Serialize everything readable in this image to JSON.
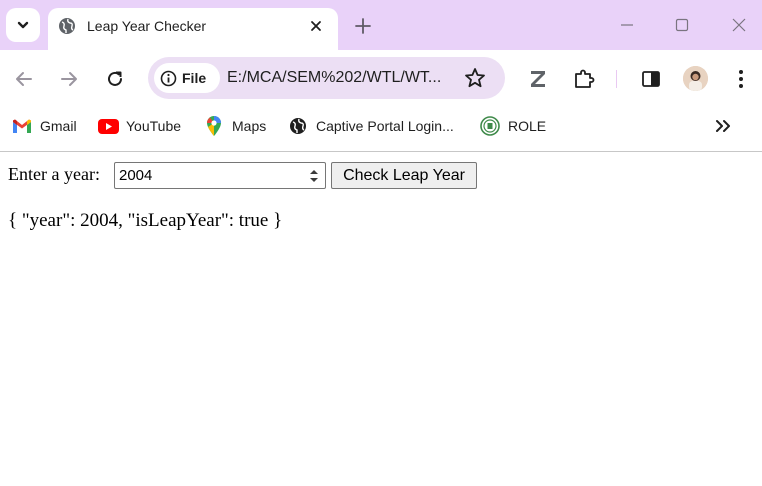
{
  "tab": {
    "title": "Leap Year Checker"
  },
  "omnibox": {
    "chip_label": "File",
    "url": "E:/MCA/SEM%202/WTL/WT..."
  },
  "bookmarks": [
    {
      "label": "Gmail",
      "icon": "gmail-icon"
    },
    {
      "label": "YouTube",
      "icon": "youtube-icon"
    },
    {
      "label": "Maps",
      "icon": "maps-icon"
    },
    {
      "label": "Captive Portal Login...",
      "icon": "globe-icon"
    },
    {
      "label": "ROLE",
      "icon": "role-icon"
    }
  ],
  "form": {
    "label": "Enter a year:",
    "year_value": "2004",
    "button_label": "Check Leap Year"
  },
  "result": {
    "text": "{ \"year\": 2004, \"isLeapYear\": true }"
  },
  "colors": {
    "tabstrip": "#e9d2f9",
    "omnibox": "#ecdff4",
    "youtube_red": "#ff0000"
  }
}
